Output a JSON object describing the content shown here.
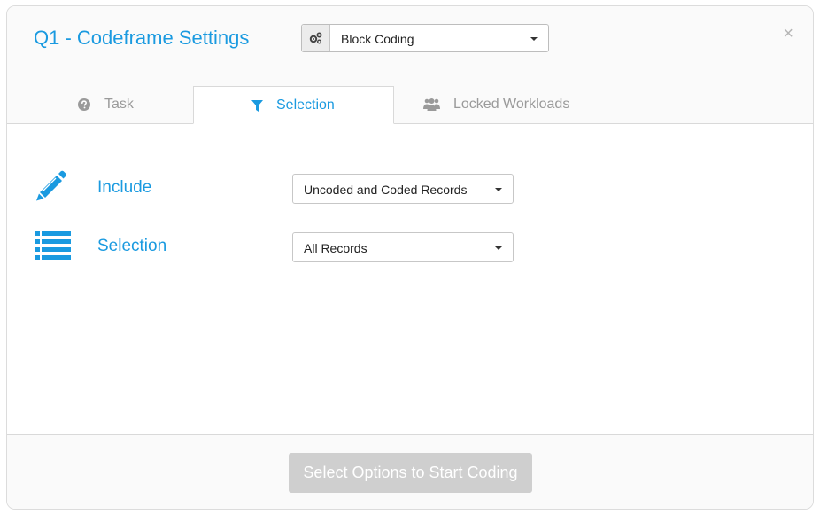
{
  "header": {
    "title": "Q1 - Codeframe Settings",
    "mode_select": {
      "value": "Block Coding",
      "addon_icon": "gears-icon"
    },
    "close_label": "×"
  },
  "tabs": [
    {
      "label": "Task",
      "icon": "question-circle-icon",
      "active": false
    },
    {
      "label": "Selection",
      "icon": "filter-icon",
      "active": true
    },
    {
      "label": "Locked Workloads",
      "icon": "users-icon",
      "active": false
    }
  ],
  "selection": {
    "include": {
      "label": "Include",
      "icon": "pencil-icon",
      "value": "Uncoded and Coded Records"
    },
    "selection": {
      "label": "Selection",
      "icon": "list-icon",
      "value": "All Records"
    }
  },
  "footer": {
    "start_button": "Select Options to Start Coding"
  },
  "colors": {
    "accent": "#1a9ae0",
    "muted": "#9a9a9a",
    "disabled_button": "#cfcfcf"
  }
}
